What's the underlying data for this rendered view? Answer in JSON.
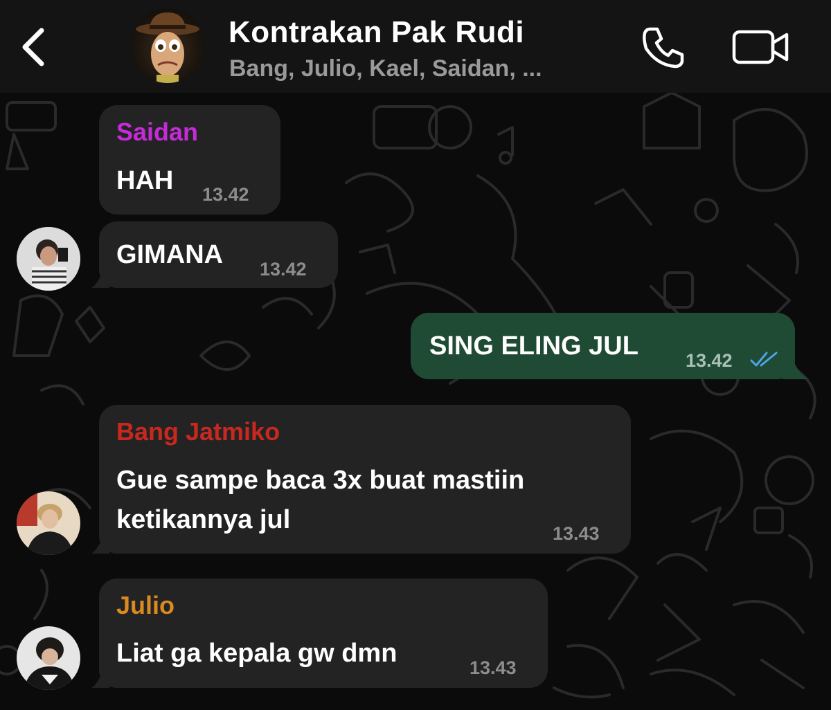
{
  "header": {
    "title": "Kontrakan Pak Rudi",
    "subtitle": "Bang, Julio, Kael, Saidan, ...",
    "back_icon": "chevron-left-icon",
    "call_icon": "phone-icon",
    "video_icon": "video-camera-icon"
  },
  "colors": {
    "background": "#0b0b0b",
    "incoming_bubble": "#232323",
    "outgoing_bubble": "#1f4a33",
    "read_ticks": "#4fa3e6",
    "sender_saidan": "#c52bd8",
    "sender_bang_jatmiko": "#c8281f",
    "sender_julio": "#d98a20"
  },
  "messages": [
    {
      "sender": "Saidan",
      "text": "HAH",
      "time": "13.42"
    },
    {
      "text": "GIMANA",
      "time": "13.42"
    },
    {
      "text": "SING ELING JUL",
      "time": "13.42",
      "status_icon": "double-check-read-icon"
    },
    {
      "sender": "Bang Jatmiko",
      "text_line1": "Gue sampe baca 3x buat mastiin",
      "text_line2": "ketikannya jul",
      "time": "13.43"
    },
    {
      "sender": "Julio",
      "text": "Liat ga kepala gw dmn",
      "time": "13.43"
    }
  ]
}
